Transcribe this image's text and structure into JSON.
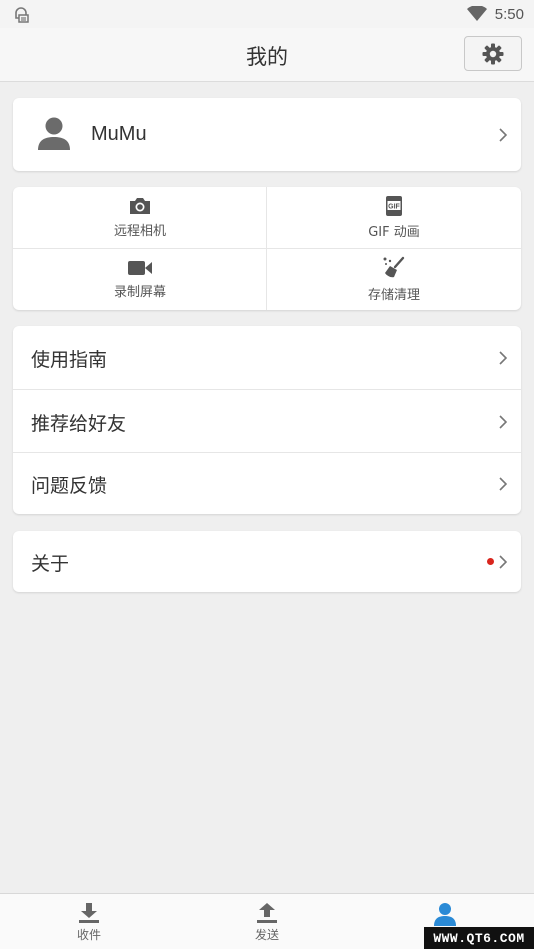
{
  "status_bar": {
    "time": "5:50",
    "wifi_icon": "wifi-icon",
    "notification_icon": "android-notification-icon"
  },
  "header": {
    "title": "我的",
    "settings_icon": "gear-icon"
  },
  "profile": {
    "name": "MuMu",
    "avatar_icon": "user-icon"
  },
  "tools": [
    {
      "label": "远程相机",
      "icon": "camera-icon"
    },
    {
      "label": "GIF 动画",
      "icon": "gif-icon"
    },
    {
      "label": "录制屏幕",
      "icon": "video-camera-icon"
    },
    {
      "label": "存储清理",
      "icon": "broom-icon"
    }
  ],
  "menu": [
    {
      "label": "使用指南"
    },
    {
      "label": "推荐给好友"
    },
    {
      "label": "问题反馈"
    }
  ],
  "about": {
    "label": "关于",
    "has_badge": true
  },
  "bottom_nav": [
    {
      "label": "收件",
      "icon": "download-icon",
      "active": false
    },
    {
      "label": "发送",
      "icon": "upload-icon",
      "active": false
    },
    {
      "label": "",
      "icon": "user-icon",
      "active": true
    }
  ],
  "watermark": "WWW.QT6.COM",
  "colors": {
    "accent": "#2a8ad6",
    "badge": "#d9251d",
    "background": "#efefef"
  }
}
